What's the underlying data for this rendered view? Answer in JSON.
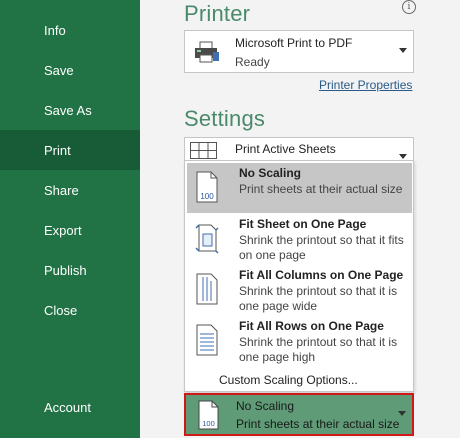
{
  "sidebar": {
    "items": [
      {
        "label": "Info"
      },
      {
        "label": "Save"
      },
      {
        "label": "Save As"
      },
      {
        "label": "Print",
        "active": true
      },
      {
        "label": "Share"
      },
      {
        "label": "Export"
      },
      {
        "label": "Publish"
      },
      {
        "label": "Close"
      },
      {
        "label": "Account"
      }
    ]
  },
  "printer": {
    "section_title": "Printer",
    "info_glyph": "i",
    "name": "Microsoft Print to PDF",
    "status": "Ready",
    "properties_link": "Printer Properties"
  },
  "settings": {
    "section_title": "Settings",
    "print_what": "Print Active Sheets",
    "scaling_options": [
      {
        "title": "No Scaling",
        "description": "Print sheets at their actual size",
        "icon": "page-100-icon",
        "selected": true
      },
      {
        "title": "Fit Sheet on One Page",
        "description": "Shrink the printout so that it fits on one page",
        "icon": "fit-sheet-icon"
      },
      {
        "title": "Fit All Columns on One Page",
        "description": "Shrink the printout so that it is one page wide",
        "icon": "fit-columns-icon"
      },
      {
        "title": "Fit All Rows on One Page",
        "description": "Shrink the printout so that it is one page high",
        "icon": "fit-rows-icon"
      }
    ],
    "custom_scaling": "Custom Scaling Options...",
    "current_scaling": {
      "title": "No Scaling",
      "description": "Print sheets at their actual size",
      "icon_text": "100"
    },
    "icon_text": "100"
  },
  "colors": {
    "sidebar": "#217346",
    "sidebar_active": "#185c37",
    "accent_title": "#4a8a6a",
    "selected_box": "#5e9b76",
    "highlight_border": "#d01818"
  }
}
